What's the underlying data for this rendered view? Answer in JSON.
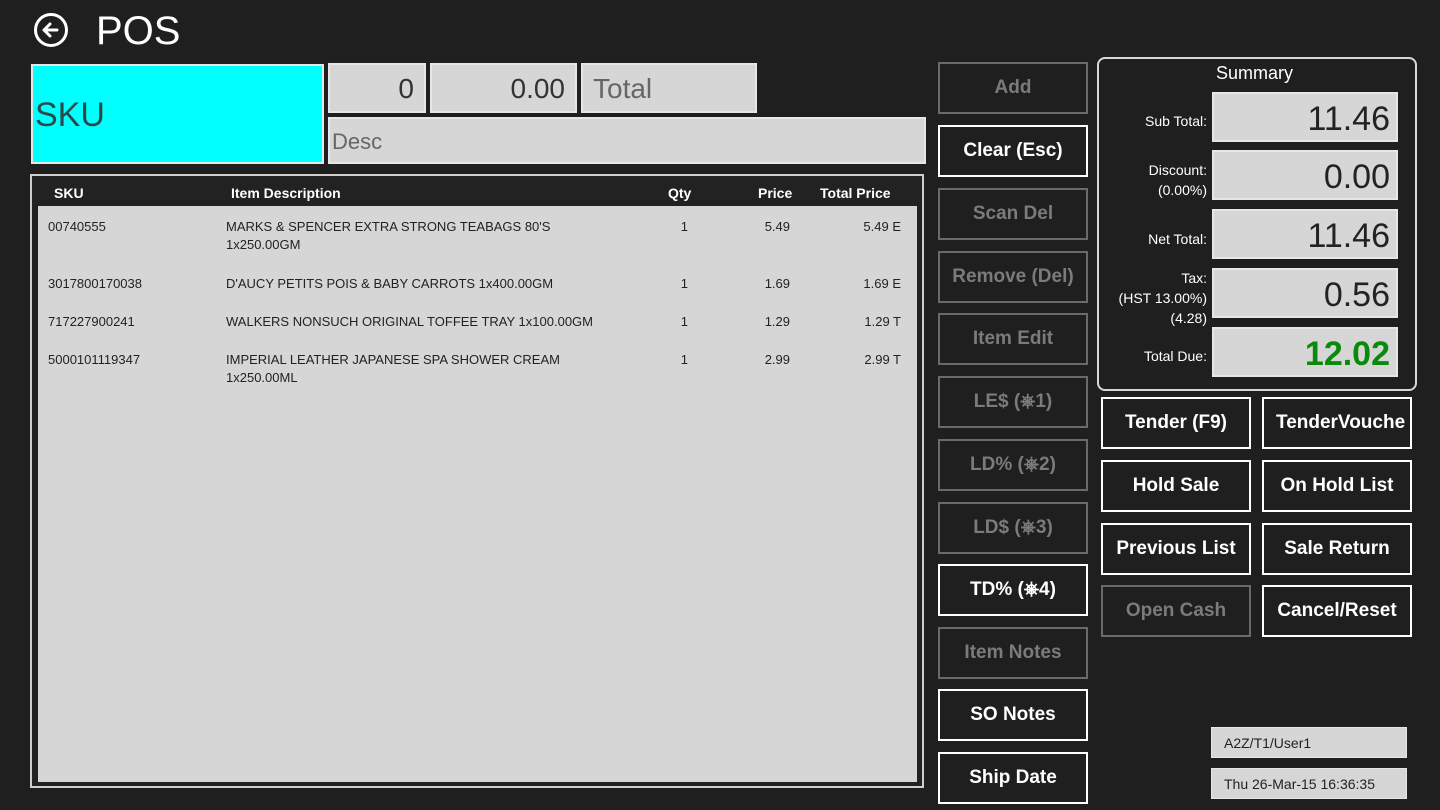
{
  "app": {
    "title": "POS"
  },
  "entry": {
    "sku_placeholder": "SKU",
    "qty": "0",
    "price": "0.00",
    "total_placeholder": "Total",
    "desc_placeholder": "Desc"
  },
  "table": {
    "headers": {
      "sku": "SKU",
      "desc": "Item Description",
      "qty": "Qty",
      "price": "Price",
      "total": "Total Price"
    },
    "rows": [
      {
        "sku": "00740555",
        "desc": "MARKS & SPENCER EXTRA STRONG TEABAGS 80'S 1x250.00GM",
        "qty": "1",
        "price": "5.49",
        "total": "5.49 E"
      },
      {
        "sku": "3017800170038",
        "desc": "D'AUCY PETITS POIS & BABY CARROTS 1x400.00GM",
        "qty": "1",
        "price": "1.69",
        "total": "1.69 E"
      },
      {
        "sku": "717227900241",
        "desc": "WALKERS NONSUCH ORIGINAL TOFFEE TRAY  1x100.00GM",
        "qty": "1",
        "price": "1.29",
        "total": "1.29 T"
      },
      {
        "sku": "5000101119347",
        "desc": "IMPERIAL LEATHER JAPANESE SPA SHOWER CREAM 1x250.00ML",
        "qty": "1",
        "price": "2.99",
        "total": "2.99 T"
      }
    ]
  },
  "actions": {
    "add": "Add",
    "clear": "Clear (Esc)",
    "scan_del": "Scan Del",
    "remove": "Remove (Del)",
    "item_edit": "Item Edit",
    "le": "LE$ (⎈1)",
    "ld_pct": "LD% (⎈2)",
    "ld_amt": "LD$ (⎈3)",
    "td_pct": "TD% (⎈4)",
    "item_notes": "Item Notes",
    "so_notes": "SO Notes",
    "ship_date": "Ship Date"
  },
  "summary": {
    "title": "Summary",
    "sub_total_label": "Sub Total:",
    "sub_total": "11.46",
    "discount_label": "Discount:",
    "discount_pct": "(0.00%)",
    "discount": "0.00",
    "net_total_label": "Net Total:",
    "net_total": "11.46",
    "tax_label": "Tax:",
    "tax_rate": "(HST 13.00%)",
    "tax_base": "(4.28)",
    "tax": "0.56",
    "total_due_label": "Total Due:",
    "total_due": "12.02"
  },
  "sale": {
    "tender": "Tender (F9)",
    "tender_voucher": "TenderVouche",
    "hold_sale": "Hold Sale",
    "on_hold_list": "On Hold List",
    "previous_list": "Previous List",
    "sale_return": "Sale Return",
    "open_cash": "Open Cash",
    "cancel_reset": "Cancel/Reset"
  },
  "status": {
    "user": "A2Z/T1/User1",
    "datetime": "Thu 26-Mar-15 16:36:35"
  },
  "colors": {
    "background": "#1f1f1f",
    "sku_field": "#00ffff",
    "field": "#d6d6d6",
    "total_due": "#0a8a0a"
  }
}
